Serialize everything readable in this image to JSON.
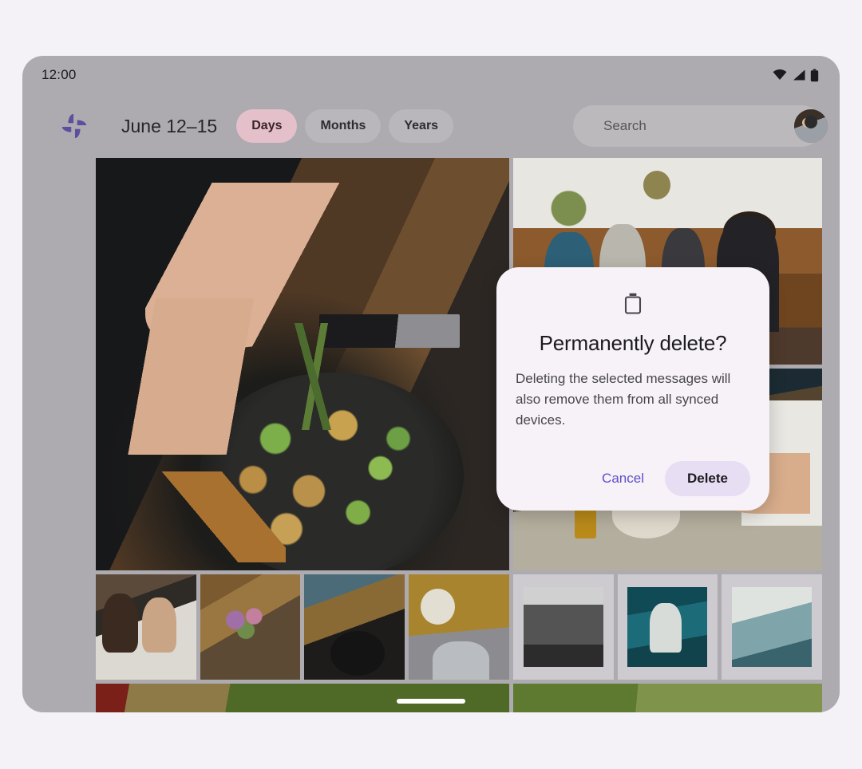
{
  "status_bar": {
    "time": "12:00",
    "icons": [
      "wifi-icon",
      "cellular-signal-icon",
      "battery-icon"
    ]
  },
  "app_bar": {
    "logo": "google-photos-pinwheel-icon",
    "date_range": "June 12–15",
    "chips": [
      {
        "label": "Days",
        "selected": true
      },
      {
        "label": "Months",
        "selected": false
      },
      {
        "label": "Years",
        "selected": false
      }
    ],
    "search": {
      "icon": "search-icon",
      "placeholder": "Search",
      "value": ""
    },
    "avatar": "user-avatar"
  },
  "grid": {
    "photos": [
      {
        "name": "photo-cooking-herbs-pan"
      },
      {
        "name": "photo-group-living-room"
      },
      {
        "name": "photo-dinner-table"
      },
      {
        "name": "thumb-couple-drinking"
      },
      {
        "name": "thumb-flowers-table"
      },
      {
        "name": "thumb-cooking-skillet"
      },
      {
        "name": "thumb-cutting-board"
      },
      {
        "name": "polaroid-bw-group"
      },
      {
        "name": "polaroid-teal-portrait"
      },
      {
        "name": "polaroid-cyan-room"
      },
      {
        "name": "photo-grass-field-left"
      },
      {
        "name": "photo-grass-field-right"
      }
    ]
  },
  "dialog": {
    "icon": "trash-delete-icon",
    "title": "Permanently delete?",
    "body": "Deleting the selected messages will also remove them from all synced devices.",
    "cancel_label": "Cancel",
    "delete_label": "Delete"
  },
  "colors": {
    "page_background": "#f4f2f6",
    "device_frame": "#adabaf",
    "dialog_surface": "#f7f2f8",
    "chip_selected": "#e4c0cb",
    "chip_default": "#bebac0",
    "accent_purple": "#5f4ec9",
    "delete_button": "#e7def4",
    "logo_purple": "#5b4f9e"
  },
  "home_indicator": "home-gesture-bar"
}
